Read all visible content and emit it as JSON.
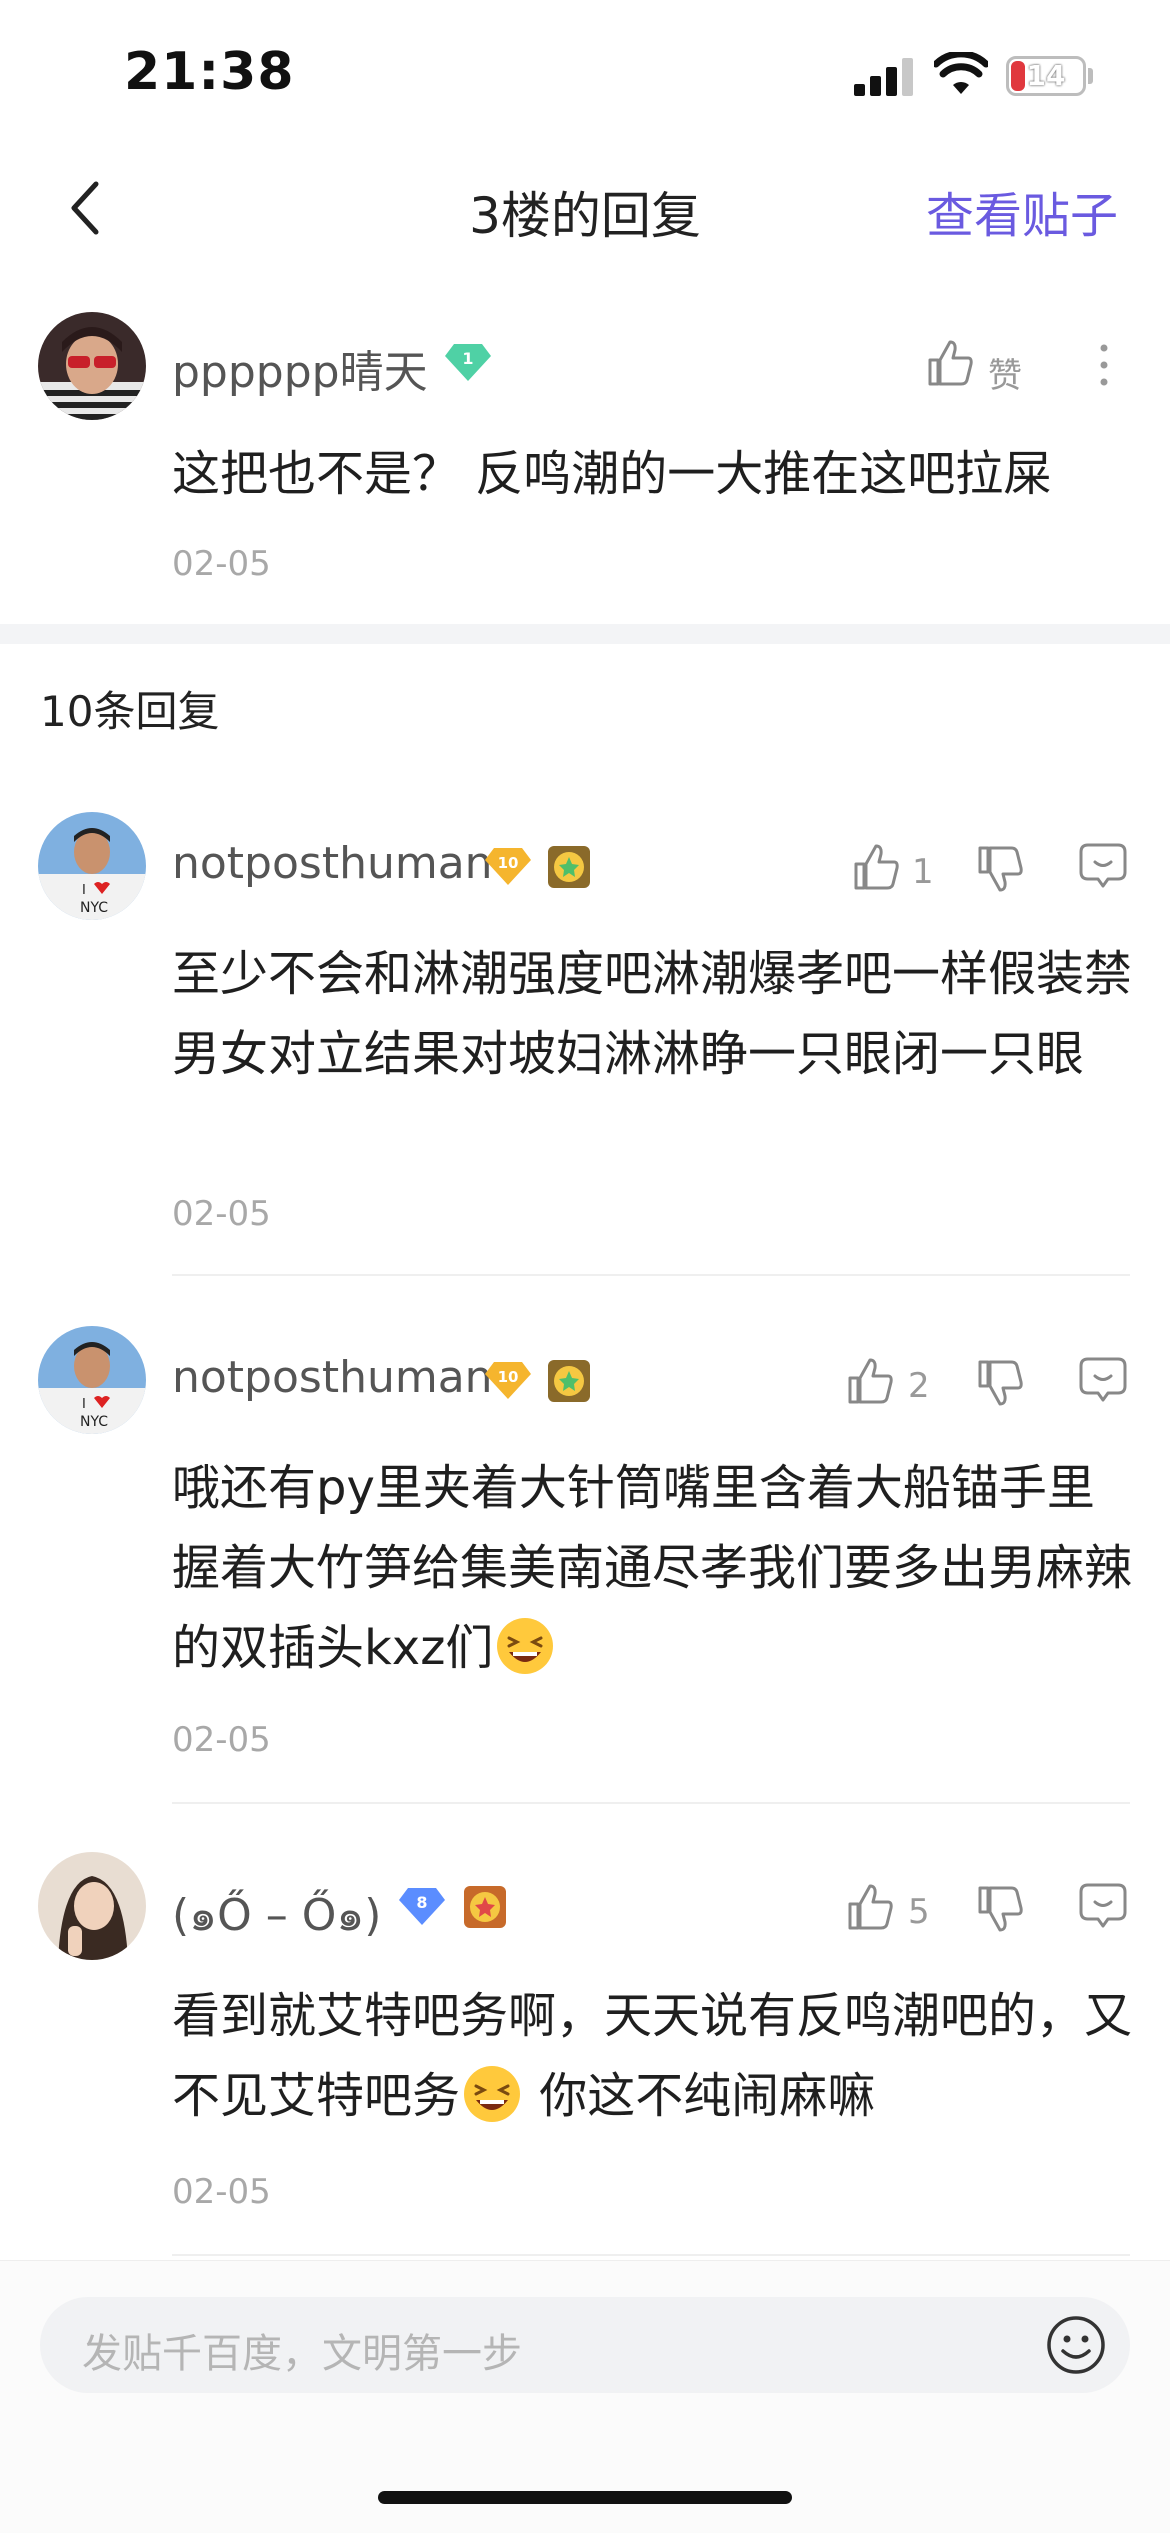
{
  "status_bar": {
    "time": "21:38",
    "battery": "14"
  },
  "nav": {
    "title": "3楼的回复",
    "view_post": "查看贴子"
  },
  "main_post": {
    "username": "pppppp晴天",
    "level": "1",
    "like_label": "赞",
    "content": "这把也不是？ 反鸣潮的一大推在这吧拉屎",
    "date": "02-05"
  },
  "replies_header": "10条回复",
  "replies": [
    {
      "username": "notposthuman",
      "level": "10",
      "likes": "1",
      "content": "至少不会和淋潮强度吧淋潮爆孝吧一样假装禁男女对立结果对坡妇淋淋睁一只眼闭一只眼",
      "date": "02-05"
    },
    {
      "username": "notposthuman",
      "level": "10",
      "likes": "2",
      "content": "哦还有py里夹着大针筒嘴里含着大船锚手里握着大竹笋给集美南通尽孝我们要多出男麻辣的双插头kxz们",
      "date": "02-05"
    },
    {
      "username": "(๑Ő – Ő๑)",
      "level": "8",
      "likes": "5",
      "content_a": "看到就艾特吧务啊，天天说有反鸣潮吧的，又不见艾特吧务",
      "content_b": " 你这不纯闹麻嘛",
      "date": "02-05"
    }
  ],
  "composer": {
    "placeholder": "发贴千百度，文明第一步"
  },
  "colors": {
    "accent": "#6a5ae0",
    "level_gold": "#f5b52e",
    "level_teal": "#4fd1a5",
    "level_blue": "#5b8dff"
  },
  "icons": [
    "back-icon",
    "thumbs-up-icon",
    "thumbs-down-icon",
    "comment-icon",
    "more-icon",
    "emoji-icon"
  ]
}
